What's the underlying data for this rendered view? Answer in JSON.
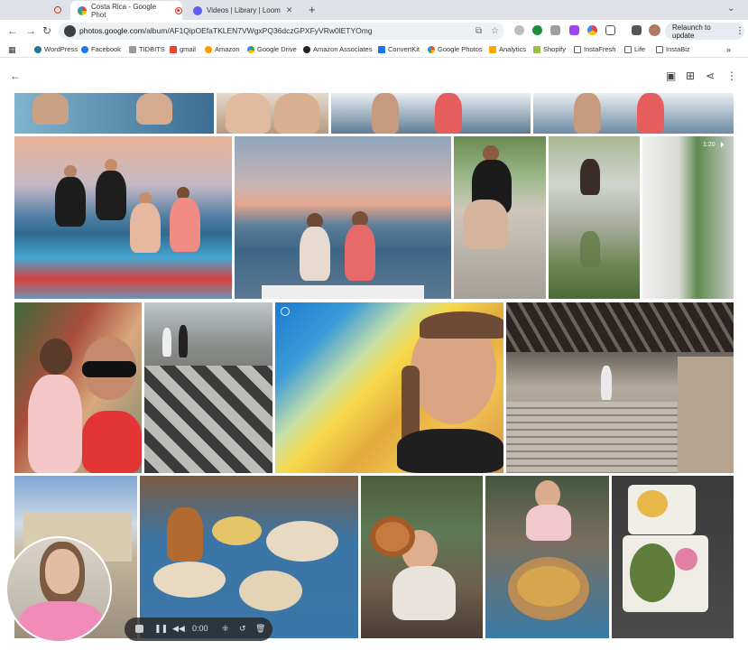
{
  "tabs": [
    {
      "title": "Costa Rica - Google Phot",
      "active": true,
      "favicon_color": "#ea4335"
    },
    {
      "title": "Videos | Library | Loom",
      "active": false,
      "favicon_color": "#625df5"
    }
  ],
  "address_bar": {
    "url_host": "photos.google.com",
    "url_path": "/album/AF1QipOEfaTKLEN7VWgxPQ36dczGPXFyVRw0lETYOmg",
    "relaunch_label": "Relaunch to update"
  },
  "bookmarks": [
    {
      "label": "WordPress",
      "color": "#21759b"
    },
    {
      "label": "Facebook",
      "color": "#1877f2"
    },
    {
      "label": "TIDBITS",
      "color": "#888888"
    },
    {
      "label": "gmail",
      "color": "#ea4335"
    },
    {
      "label": "Amazon",
      "color": "#222222"
    },
    {
      "label": "Google Drive",
      "color": "#34a853"
    },
    {
      "label": "Amazon Associates",
      "color": "#222222"
    },
    {
      "label": "ConvertKit",
      "color": "#1a73e8"
    },
    {
      "label": "Google Photos",
      "color": "#fbbc04"
    },
    {
      "label": "Analytics",
      "color": "#f9ab00"
    },
    {
      "label": "Shopify",
      "color": "#95bf47"
    },
    {
      "label": "InstaFresh",
      "color": "#666666"
    },
    {
      "label": "Life",
      "color": "#666666"
    },
    {
      "label": "InstaBiz",
      "color": "#666666"
    }
  ],
  "photos": {
    "video_duration": "1:20"
  },
  "loom": {
    "time": "0:00"
  },
  "colors": {
    "accent": "#1a73e8",
    "record_red": "#d93025"
  }
}
